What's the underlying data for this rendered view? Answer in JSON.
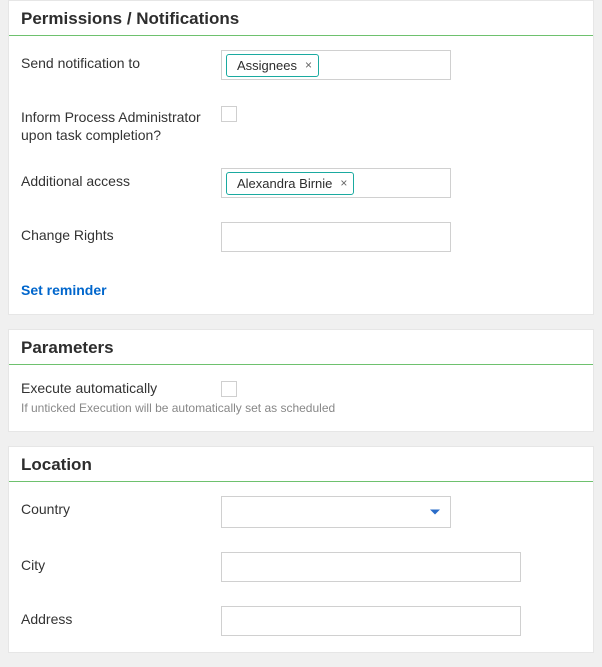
{
  "permissions": {
    "title": "Permissions / Notifications",
    "send_notification_label": "Send notification to",
    "send_notification_tags": [
      "Assignees"
    ],
    "inform_admin_label": "Inform Process Administrator upon task completion?",
    "inform_admin_checked": false,
    "additional_access_label": "Additional access",
    "additional_access_tags": [
      "Alexandra Birnie"
    ],
    "change_rights_label": "Change Rights",
    "set_reminder_link": "Set reminder"
  },
  "parameters": {
    "title": "Parameters",
    "execute_auto_label": "Execute automatically",
    "execute_auto_hint": "If unticked Execution will be automatically set as scheduled",
    "execute_auto_checked": false
  },
  "location": {
    "title": "Location",
    "country_label": "Country",
    "country_value": "",
    "city_label": "City",
    "city_value": "",
    "address_label": "Address",
    "address_value": ""
  }
}
